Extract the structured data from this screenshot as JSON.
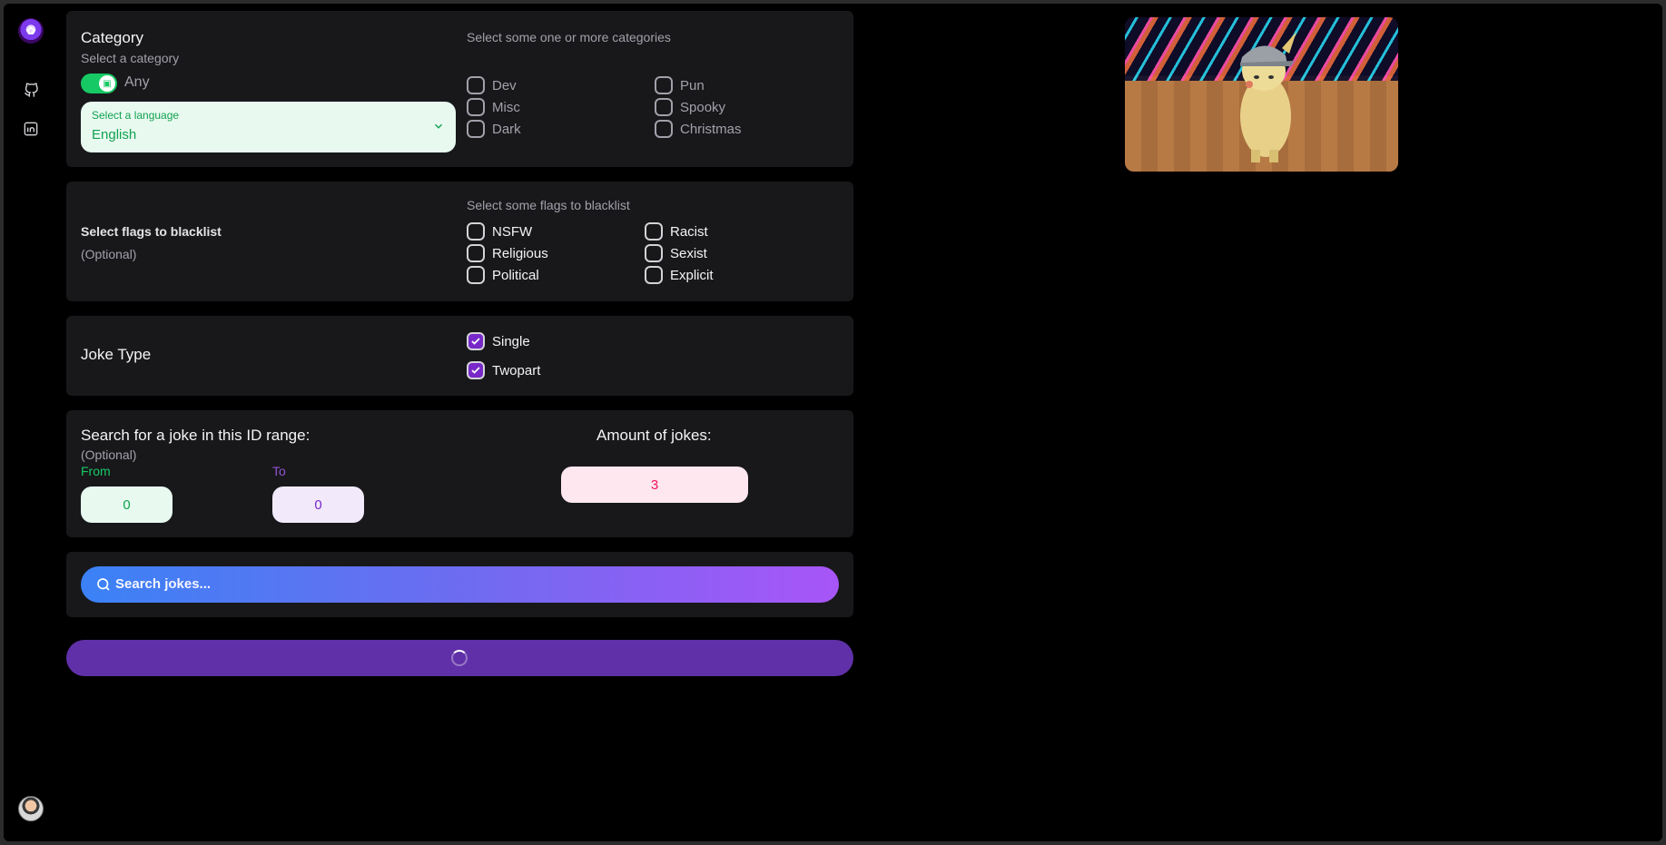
{
  "sidebar": {
    "logo_icon": "app-logo",
    "items": [
      {
        "icon": "github-icon"
      },
      {
        "icon": "linkedin-icon"
      }
    ],
    "avatar": "user-avatar"
  },
  "category": {
    "title": "Category",
    "subtitle": "Select a category",
    "toggle_label": "Any",
    "toggle_on": true,
    "language": {
      "label": "Select a language",
      "value": "English"
    },
    "hint": "Select some one or more categories",
    "options": [
      {
        "label": "Dev",
        "checked": false
      },
      {
        "label": "Pun",
        "checked": false
      },
      {
        "label": "Misc",
        "checked": false
      },
      {
        "label": "Spooky",
        "checked": false
      },
      {
        "label": "Dark",
        "checked": false
      },
      {
        "label": "Christmas",
        "checked": false
      }
    ]
  },
  "blacklist": {
    "title": "Select flags to blacklist",
    "optional": "(Optional)",
    "hint": "Select some flags to blacklist",
    "flags": [
      {
        "label": "NSFW",
        "checked": false
      },
      {
        "label": "Racist",
        "checked": false
      },
      {
        "label": "Religious",
        "checked": false
      },
      {
        "label": "Sexist",
        "checked": false
      },
      {
        "label": "Political",
        "checked": false
      },
      {
        "label": "Explicit",
        "checked": false
      }
    ]
  },
  "joke_type": {
    "title": "Joke Type",
    "options": [
      {
        "label": "Single",
        "checked": true
      },
      {
        "label": "Twopart",
        "checked": true
      }
    ]
  },
  "id_range": {
    "title": "Search for a joke in this ID range:",
    "optional": "(Optional)",
    "from_label": "From",
    "from_value": "0",
    "to_label": "To",
    "to_value": "0",
    "amount_title": "Amount of jokes:",
    "amount_value": "3"
  },
  "search": {
    "placeholder": "Search jokes..."
  },
  "colors": {
    "accent_purple": "#7828c8",
    "success_green": "#17c964",
    "submit_bg": "#6030a8",
    "panel_bg": "#18181b"
  },
  "media": {
    "image": "pikachu-dancing-gif"
  }
}
